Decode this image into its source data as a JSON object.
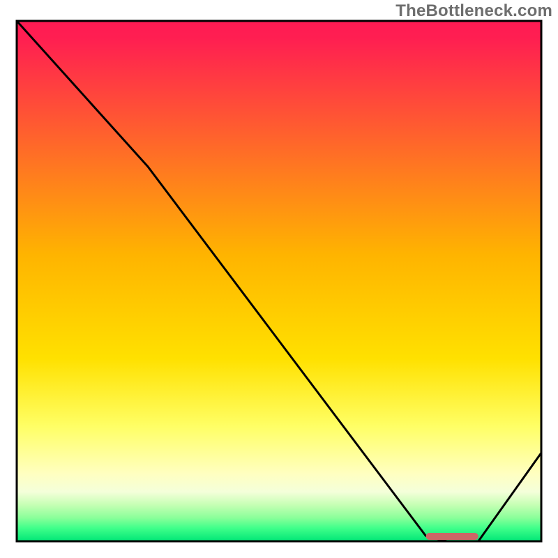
{
  "watermark": "TheBottleneck.com",
  "chart_data": {
    "type": "line",
    "title": "",
    "xlabel": "",
    "ylabel": "",
    "xlim": [
      0,
      100
    ],
    "ylim": [
      0,
      100
    ],
    "x": [
      0,
      25,
      78,
      82,
      88,
      100
    ],
    "values": [
      100,
      72,
      1,
      0,
      0,
      17
    ],
    "marker_segment": {
      "x0": 78,
      "x1": 88,
      "y": 0
    },
    "gradient_stops": [
      {
        "offset": 0.0,
        "color": "#ff1a53"
      },
      {
        "offset": 0.035,
        "color": "#ff1f51"
      },
      {
        "offset": 0.45,
        "color": "#ffb400"
      },
      {
        "offset": 0.65,
        "color": "#ffe100"
      },
      {
        "offset": 0.78,
        "color": "#ffff66"
      },
      {
        "offset": 0.87,
        "color": "#ffffc0"
      },
      {
        "offset": 0.905,
        "color": "#f4ffda"
      },
      {
        "offset": 0.93,
        "color": "#c6ffb4"
      },
      {
        "offset": 0.955,
        "color": "#8aff9a"
      },
      {
        "offset": 0.975,
        "color": "#3fff8a"
      },
      {
        "offset": 1.0,
        "color": "#00e676"
      }
    ],
    "colors": {
      "line": "#000000",
      "marker": "#cc6666",
      "border": "#000000"
    }
  }
}
